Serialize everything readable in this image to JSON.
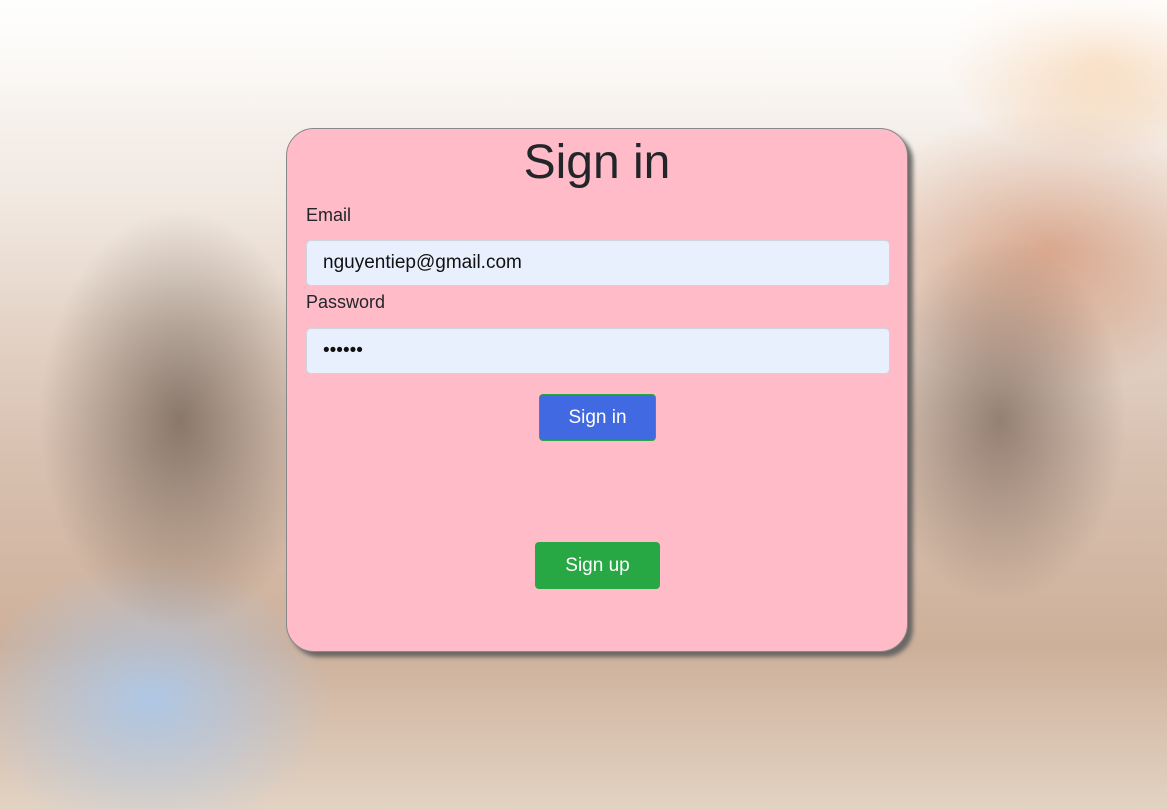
{
  "form": {
    "title": "Sign in",
    "email_label": "Email",
    "email_value": "nguyentiep@gmail.com",
    "password_label": "Password",
    "password_value": "123456",
    "signin_label": "Sign in",
    "signup_label": "Sign up"
  },
  "colors": {
    "card": "#ffbbc8",
    "signin": "#4169e1",
    "signup": "#28a745"
  }
}
